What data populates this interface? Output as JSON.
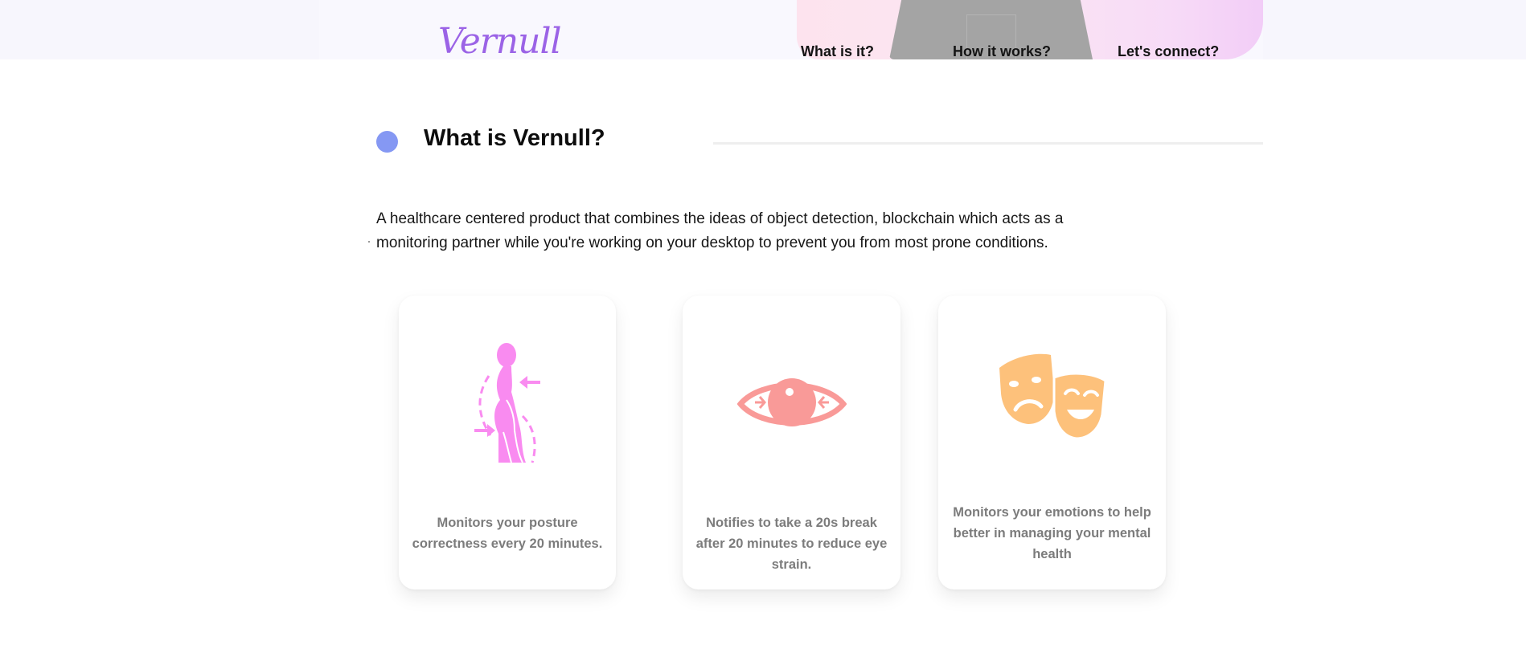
{
  "header": {
    "logo_text": "Vernull",
    "nav": [
      {
        "label": "What is it?"
      },
      {
        "label": "How it works?"
      },
      {
        "label": "Let's connect?"
      }
    ]
  },
  "section": {
    "title": "What is Vernull?",
    "intro_line1": "A healthcare centered product that combines the ideas of object detection, blockchain which acts as a",
    "intro_line2": "monitoring partner while you're working on your desktop to prevent you from most prone conditions."
  },
  "features": [
    {
      "icon": "posture-icon",
      "text": "Monitors your posture correctness every 20 minutes."
    },
    {
      "icon": "eye-icon",
      "text": "Notifies to take a 20s break after 20 minutes to reduce eye strain."
    },
    {
      "icon": "theater-masks-icon",
      "text": "Monitors your emotions to help better in managing your mental health"
    }
  ],
  "colors": {
    "logo": "#9b63e6",
    "accent_dot": "#8598f3",
    "posture_icon": "#f98bf0",
    "eye_icon": "#f99a98",
    "masks_icon": "#fdc17b",
    "card_text": "#7c7c7c"
  }
}
